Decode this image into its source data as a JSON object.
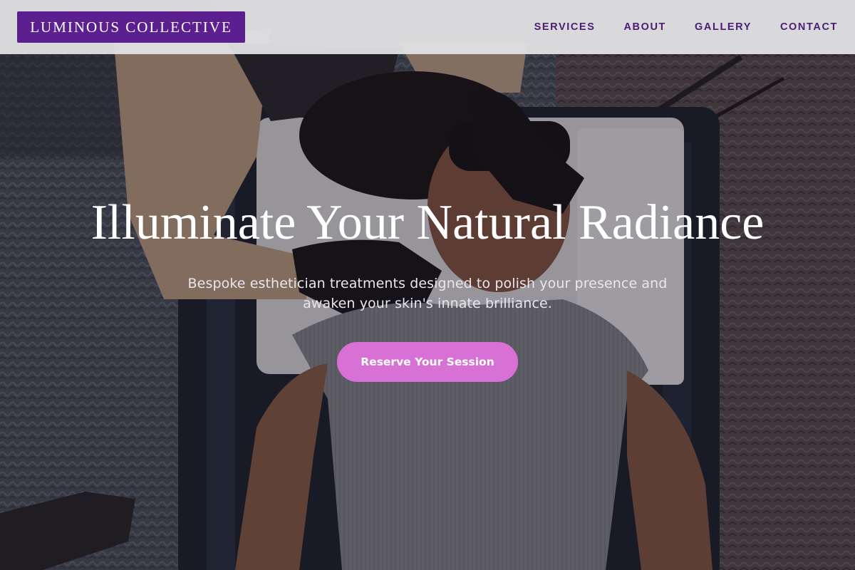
{
  "brand": {
    "name": "LUMINOUS COLLECTIVE"
  },
  "nav": {
    "items": [
      {
        "label": "SERVICES"
      },
      {
        "label": "ABOUT"
      },
      {
        "label": "GALLERY"
      },
      {
        "label": "CONTACT"
      }
    ]
  },
  "hero": {
    "headline": "Illuminate Your Natural Radiance",
    "subtitle": "Bespoke esthetician treatments designed to polish your presence and awaken your skin's innate brilliance.",
    "cta_label": "Reserve Your Session",
    "background_image": "esthetician-treatment-photo"
  },
  "colors": {
    "brand_purple": "#5b1f8f",
    "nav_text": "#4a1d73",
    "cta_pink": "#d871d5",
    "header_bg": "#e2e2e4"
  }
}
